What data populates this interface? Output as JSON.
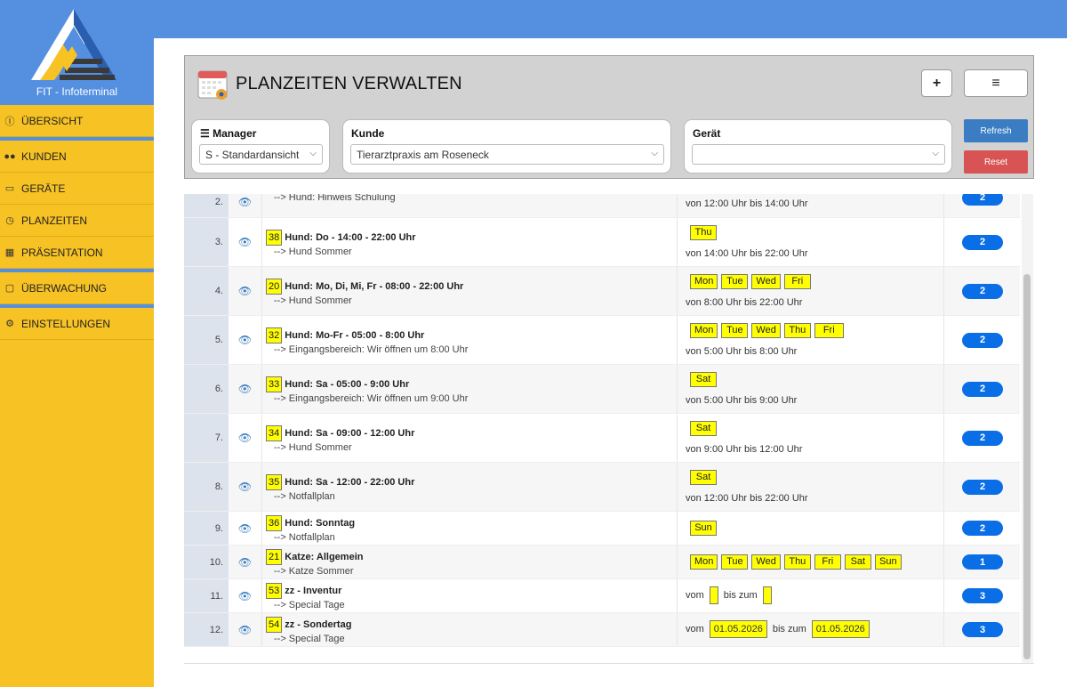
{
  "app": {
    "brand_title": "FIT - Infoterminal",
    "accent_color": "#548fe0",
    "sidebar_color": "#f7c224"
  },
  "sidebar": {
    "items": [
      {
        "label": "ÜBERSICHT",
        "icon": "info-icon"
      },
      {
        "label": "KUNDEN",
        "icon": "users-icon"
      },
      {
        "label": "GERÄTE",
        "icon": "monitor-icon"
      },
      {
        "label": "PLANZEITEN",
        "icon": "clock-icon"
      },
      {
        "label": "PRÄSENTATION",
        "icon": "film-icon"
      },
      {
        "label": "ÜBERWACHUNG",
        "icon": "note-icon"
      },
      {
        "label": "EINSTELLUNGEN",
        "icon": "gears-icon"
      }
    ]
  },
  "header": {
    "title": "PLANZEITEN VERWALTEN",
    "add_label": "+",
    "menu_label": "≡",
    "refresh_label": "Refresh",
    "reset_label": "Reset"
  },
  "filters": {
    "manager": {
      "label": "Manager",
      "value": "S - Standardansicht"
    },
    "kunde": {
      "label": "Kunde",
      "value": "Tierarztpraxis am Roseneck"
    },
    "geraet": {
      "label": "Gerät",
      "value": ""
    }
  },
  "rows": [
    {
      "num": "2.",
      "id": "",
      "title": "",
      "sub": "-->  Hund: Hinweis Schulung",
      "days": [],
      "time": "von 12:00 Uhr bis 14:00 Uhr",
      "count": "2"
    },
    {
      "num": "3.",
      "id": "38",
      "title": "Hund: Do - 14:00 - 22:00 Uhr",
      "sub": "-->  Hund Sommer",
      "days": [
        "Thu"
      ],
      "time": "von 14:00 Uhr bis 22:00 Uhr",
      "count": "2"
    },
    {
      "num": "4.",
      "id": "20",
      "title": "Hund: Mo, Di, Mi, Fr - 08:00 - 22:00 Uhr",
      "sub": "-->  Hund Sommer",
      "days": [
        "Mon",
        "Tue",
        "Wed",
        "Fri"
      ],
      "time": "von 8:00 Uhr bis 22:00 Uhr",
      "count": "2"
    },
    {
      "num": "5.",
      "id": "32",
      "title": "Hund: Mo-Fr - 05:00 - 8:00 Uhr",
      "sub": "-->  Eingangsbereich: Wir öffnen um 8:00 Uhr",
      "days": [
        "Mon",
        "Tue",
        "Wed",
        "Thu",
        "Fri"
      ],
      "time": "von 5:00 Uhr bis 8:00 Uhr",
      "count": "2"
    },
    {
      "num": "6.",
      "id": "33",
      "title": "Hund: Sa - 05:00 - 9:00 Uhr",
      "sub": "-->  Eingangsbereich: Wir öffnen um 9:00 Uhr",
      "days": [
        "Sat"
      ],
      "time": "von 5:00 Uhr bis 9:00 Uhr",
      "count": "2"
    },
    {
      "num": "7.",
      "id": "34",
      "title": "Hund: Sa - 09:00 - 12:00 Uhr",
      "sub": "-->  Hund Sommer",
      "days": [
        "Sat"
      ],
      "time": "von 9:00 Uhr bis 12:00 Uhr",
      "count": "2"
    },
    {
      "num": "8.",
      "id": "35",
      "title": "Hund: Sa - 12:00 - 22:00 Uhr",
      "sub": "-->  Notfallplan",
      "days": [
        "Sat"
      ],
      "time": "von 12:00 Uhr bis 22:00 Uhr",
      "count": "2"
    },
    {
      "num": "9.",
      "id": "36",
      "title": "Hund: Sonntag",
      "sub": "-->  Notfallplan",
      "days": [
        "Sun"
      ],
      "time": "",
      "count": "2"
    },
    {
      "num": "10.",
      "id": "21",
      "title": "Katze: Allgemein",
      "sub": "-->  Katze Sommer",
      "days": [
        "Mon",
        "Tue",
        "Wed",
        "Thu",
        "Fri",
        "Sat",
        "Sun"
      ],
      "time": "",
      "count": "1"
    },
    {
      "num": "11.",
      "id": "53",
      "title": "zz - Inventur",
      "sub": "-->  Special Tage",
      "days": [],
      "range": {
        "from_label": "vom",
        "from": "",
        "to_label": "bis zum",
        "to": ""
      },
      "time": "",
      "count": "3"
    },
    {
      "num": "12.",
      "id": "54",
      "title": "zz - Sondertag",
      "sub": "-->  Special Tage",
      "days": [],
      "range": {
        "from_label": "vom",
        "from": "01.05.2026",
        "to_label": "bis zum",
        "to": "01.05.2026"
      },
      "time": "",
      "count": "3"
    }
  ]
}
